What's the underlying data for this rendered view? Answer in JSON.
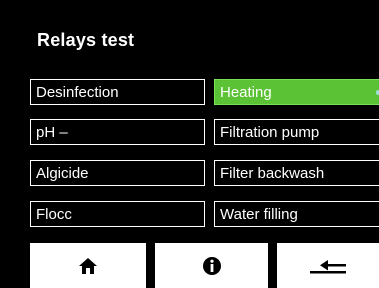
{
  "header": {
    "title": "Relays test"
  },
  "relays": [
    {
      "label": "Desinfection",
      "active": false
    },
    {
      "label": "Heating",
      "active": true
    },
    {
      "label": "pH –",
      "active": false
    },
    {
      "label": "Filtration pump",
      "active": false
    },
    {
      "label": "Algicide",
      "active": false
    },
    {
      "label": "Filter backwash",
      "active": false
    },
    {
      "label": "Flocc",
      "active": false
    },
    {
      "label": "Water filling",
      "active": false
    }
  ],
  "colors": {
    "active": "#5bc236",
    "background": "#000000",
    "border": "#ffffff"
  },
  "nav": {
    "buttons": [
      "home-icon",
      "info-icon",
      "back-arrow-icon"
    ]
  }
}
